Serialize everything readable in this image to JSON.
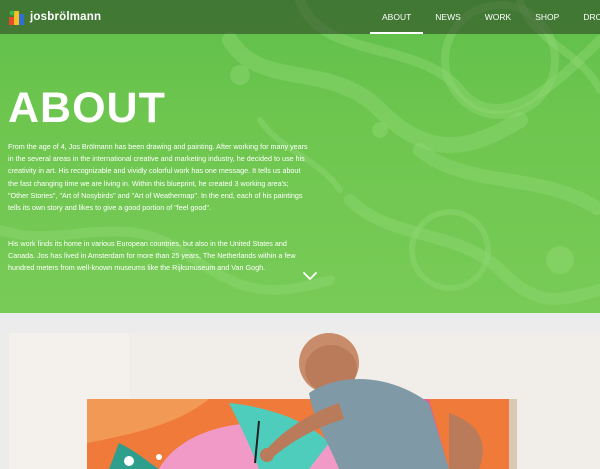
{
  "brand": {
    "name": "josbrölmann"
  },
  "nav": {
    "items": [
      {
        "label": "ABOUT",
        "active": true
      },
      {
        "label": "NEWS"
      },
      {
        "label": "WORK"
      },
      {
        "label": "SHOP"
      },
      {
        "label": "DROP A LINE"
      }
    ]
  },
  "hero": {
    "title": "ABOUT",
    "paragraphs": [
      "From the age of 4, Jos Brölmann has been drawing and painting. After working for many years in the several areas in the international creative and marketing industry, he decided to use his creativity in art. His recognizable and vividly colorful work has one message. It tells us about the fast changing time we are living in. Within this blueprint, he created 3 working area's; \"Other Stories\", \"Art of Nosybirds\" and \"Art of Weathermap\". In the end, each of his paintings tells its own story and likes to give a good portion of \"feel good\".",
      "His work finds its home in various European countries, but also in the United States and Canada. Jos has lived in Amsterdam for more than 25 years, The Netherlands within a few hundred meters from well-known museums like the Rijksmuseum and Van Gogh."
    ],
    "scroll_icon": "chevron-down-icon"
  },
  "colors": {
    "hero_green": "#6ec64f",
    "accent_white": "#ffffff",
    "page_bg": "#ececec"
  }
}
